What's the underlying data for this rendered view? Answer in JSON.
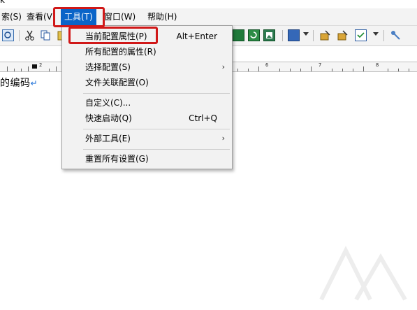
{
  "window": {
    "title_fragment": "k"
  },
  "menubar": {
    "items": [
      {
        "label": "索(S)"
      },
      {
        "label": "查看(V)"
      },
      {
        "label": "工具(T)"
      },
      {
        "label": "窗口(W)"
      },
      {
        "label": "帮助(H)"
      }
    ]
  },
  "toolbar": {
    "icons": [
      "print-preview-icon",
      "cut-icon",
      "copy-icon",
      "paste-icon",
      "view-green-icon",
      "refresh-green-icon",
      "image-view-icon",
      "book-icon",
      "config-icon-1",
      "config-icon-2",
      "check-list-icon",
      "tool-wrench-icon"
    ]
  },
  "ruler": {
    "labels": [
      "2",
      "6",
      "7",
      "8"
    ]
  },
  "document": {
    "text": "的编码",
    "paragraph_mark": "↵"
  },
  "tools_menu": {
    "items": [
      {
        "label": "当前配置属性(P)",
        "shortcut": "Alt+Enter"
      },
      {
        "label": "所有配置的属性(R)"
      },
      {
        "label": "选择配置(S)",
        "submenu": "›"
      },
      {
        "label": "文件关联配置(O)"
      },
      {
        "label": "自定义(C)..."
      },
      {
        "label": "快速启动(Q)",
        "shortcut": "Ctrl+Q"
      },
      {
        "label": "外部工具(E)",
        "submenu": "›"
      },
      {
        "label": "重置所有设置(G)"
      }
    ]
  },
  "colors": {
    "menu_active": "#0a64c8",
    "highlight_box": "#d01818",
    "paragraph_mark": "#1b6fd8"
  }
}
